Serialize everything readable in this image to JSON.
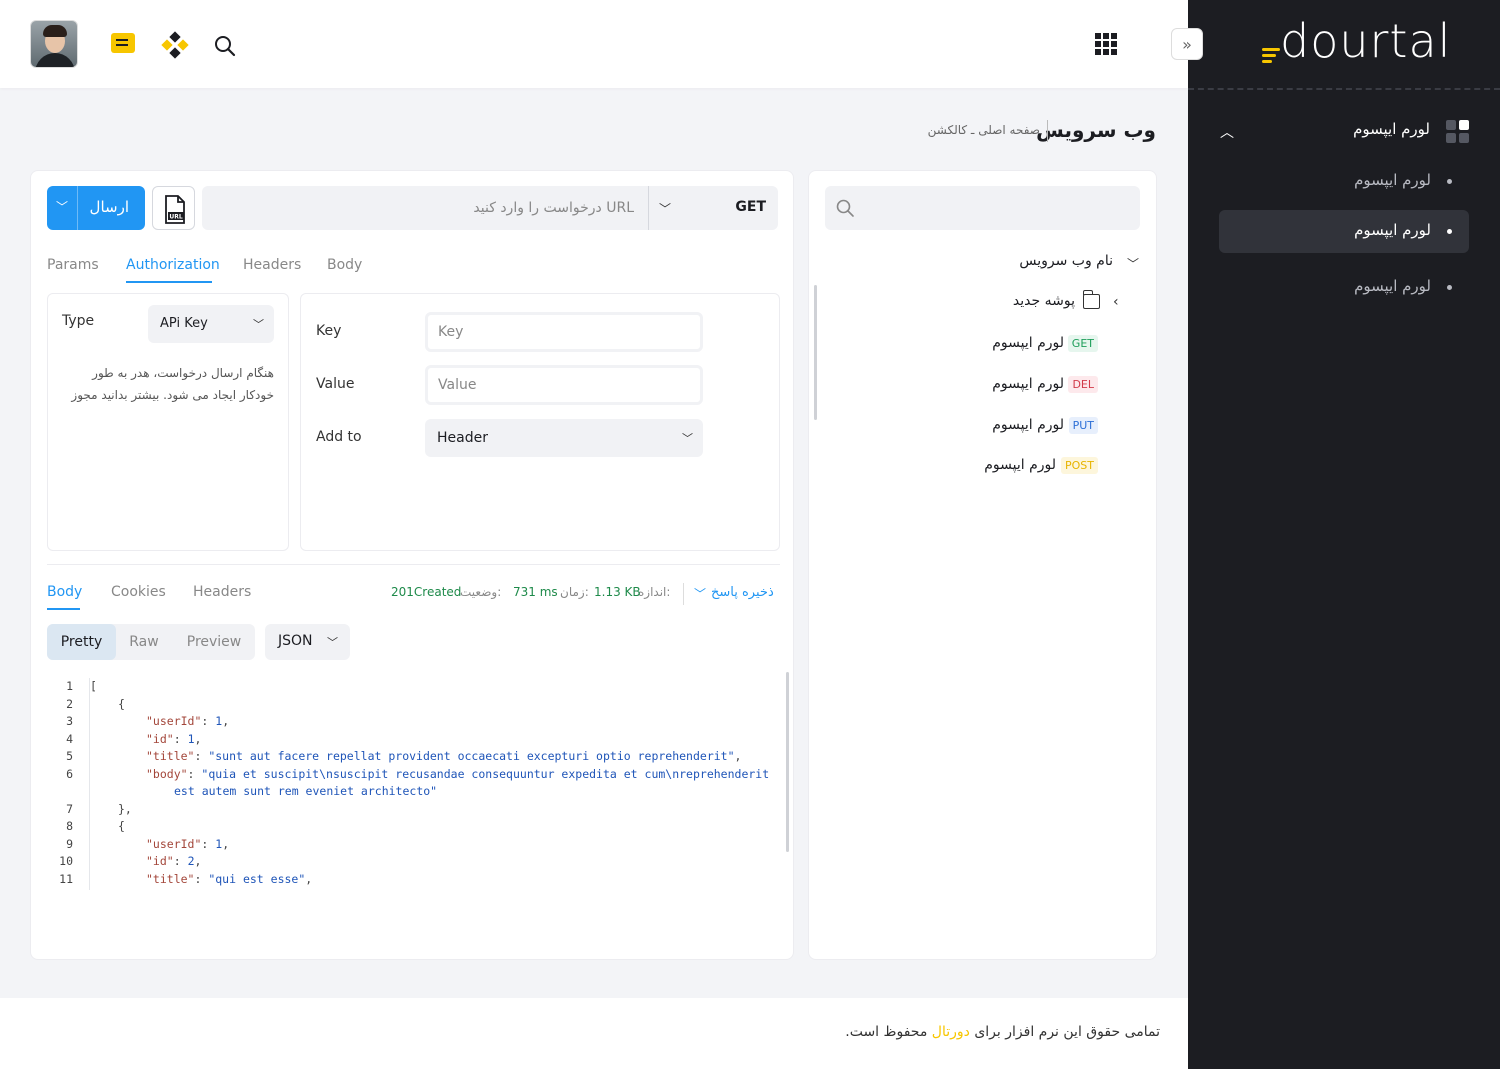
{
  "brand": {
    "name": "dourtal",
    "accent": "#f7c600",
    "primary": "#2196f3"
  },
  "sidebar": {
    "group_label": "لورم ایپسوم",
    "items": [
      {
        "label": "لورم ایپسوم",
        "active": false
      },
      {
        "label": "لورم ایپسوم",
        "active": true
      },
      {
        "label": "لورم ایپسوم",
        "active": false
      }
    ]
  },
  "topbar": {
    "icons": [
      "avatar",
      "chat-icon",
      "diamond-icon",
      "search-icon",
      "apps-icon"
    ]
  },
  "page": {
    "title": "وب سرویس",
    "breadcrumb": "صفحه اصلی ـ کالکشن"
  },
  "collection": {
    "search_placeholder": "",
    "root": "نام وب سرویس",
    "folder": "پوشه جدید",
    "requests": [
      {
        "method": "GET",
        "label": "لورم ایپسوم",
        "color": "#1e9e5a",
        "bg": "#e6f6ee"
      },
      {
        "method": "DEL",
        "label": "لورم ایپسوم",
        "color": "#d23b4a",
        "bg": "#fde9ec"
      },
      {
        "method": "PUT",
        "label": "لورم ایپسوم",
        "color": "#2d6fd6",
        "bg": "#e7effc"
      },
      {
        "method": "POST",
        "label": "لورم ایپسوم",
        "color": "#e7b400",
        "bg": "#fdf6dc"
      }
    ]
  },
  "request": {
    "send_label": "ارسال",
    "url_placeholder": "URL درخواست را وارد کنید",
    "method": "GET",
    "tabs": [
      "Params",
      "Authorization",
      "Headers",
      "Body"
    ],
    "active_tab": "Authorization"
  },
  "auth": {
    "type_label": "Type",
    "type_value": "APi Key",
    "description": "هنگام ارسال درخواست، هدر به طور خودکار ایجاد می شود. بیشتر بدانید مجوز",
    "key_label": "Key",
    "key_placeholder": "Key",
    "value_label": "Value",
    "value_placeholder": "Value",
    "addto_label": "Add to",
    "addto_value": "Header"
  },
  "response": {
    "tabs": [
      "Body",
      "Cookies",
      "Headers"
    ],
    "active_tab": "Body",
    "save_label": "ذخیره پاسخ",
    "size_label": "اندازه:",
    "size_value": "1.13 KB",
    "time_label": "زمان:",
    "time_value": "731 ms",
    "status_label": "وضعیت:",
    "status_value": "201Created",
    "views": [
      "Pretty",
      "Raw",
      "Preview"
    ],
    "active_view": "Pretty",
    "format": "JSON"
  },
  "code_lines": [
    {
      "n": "1",
      "indent": 0,
      "parts": [
        [
          "p",
          "["
        ]
      ]
    },
    {
      "n": "2",
      "indent": 1,
      "parts": [
        [
          "p",
          "{"
        ]
      ]
    },
    {
      "n": "3",
      "indent": 2,
      "parts": [
        [
          "k",
          "\"userId\""
        ],
        [
          "p",
          ": "
        ],
        [
          "n",
          "1"
        ],
        [
          "p",
          ","
        ]
      ]
    },
    {
      "n": "4",
      "indent": 2,
      "parts": [
        [
          "k",
          "\"id\""
        ],
        [
          "p",
          ": "
        ],
        [
          "n",
          "1"
        ],
        [
          "p",
          ","
        ]
      ]
    },
    {
      "n": "5",
      "indent": 2,
      "parts": [
        [
          "k",
          "\"title\""
        ],
        [
          "p",
          ": "
        ],
        [
          "s",
          "\"sunt aut facere repellat provident occaecati excepturi optio reprehenderit\""
        ],
        [
          "p",
          ","
        ]
      ]
    },
    {
      "n": "6",
      "indent": 2,
      "parts": [
        [
          "k",
          "\"body\""
        ],
        [
          "p",
          ": "
        ],
        [
          "s",
          "\"quia et suscipit\\nsuscipit recusandae consequuntur expedita et cum\\nreprehenderit"
        ]
      ]
    },
    {
      "n": "",
      "indent": 3,
      "parts": [
        [
          "s",
          "est autem sunt rem eveniet architecto\""
        ]
      ]
    },
    {
      "n": "7",
      "indent": 1,
      "parts": [
        [
          "p",
          "},"
        ]
      ]
    },
    {
      "n": "8",
      "indent": 1,
      "parts": [
        [
          "p",
          "{"
        ]
      ]
    },
    {
      "n": "9",
      "indent": 2,
      "parts": [
        [
          "k",
          "\"userId\""
        ],
        [
          "p",
          ": "
        ],
        [
          "n",
          "1"
        ],
        [
          "p",
          ","
        ]
      ]
    },
    {
      "n": "10",
      "indent": 2,
      "parts": [
        [
          "k",
          "\"id\""
        ],
        [
          "p",
          ": "
        ],
        [
          "n",
          "2"
        ],
        [
          "p",
          ","
        ]
      ]
    },
    {
      "n": "11",
      "indent": 2,
      "parts": [
        [
          "k",
          "\"title\""
        ],
        [
          "p",
          ": "
        ],
        [
          "s",
          "\"qui est esse\""
        ],
        [
          "p",
          ","
        ]
      ]
    }
  ],
  "footer": {
    "before": "تمامی حقوق این نرم افزار برای",
    "brand": "دورتال",
    "after": "محفوظ است."
  }
}
